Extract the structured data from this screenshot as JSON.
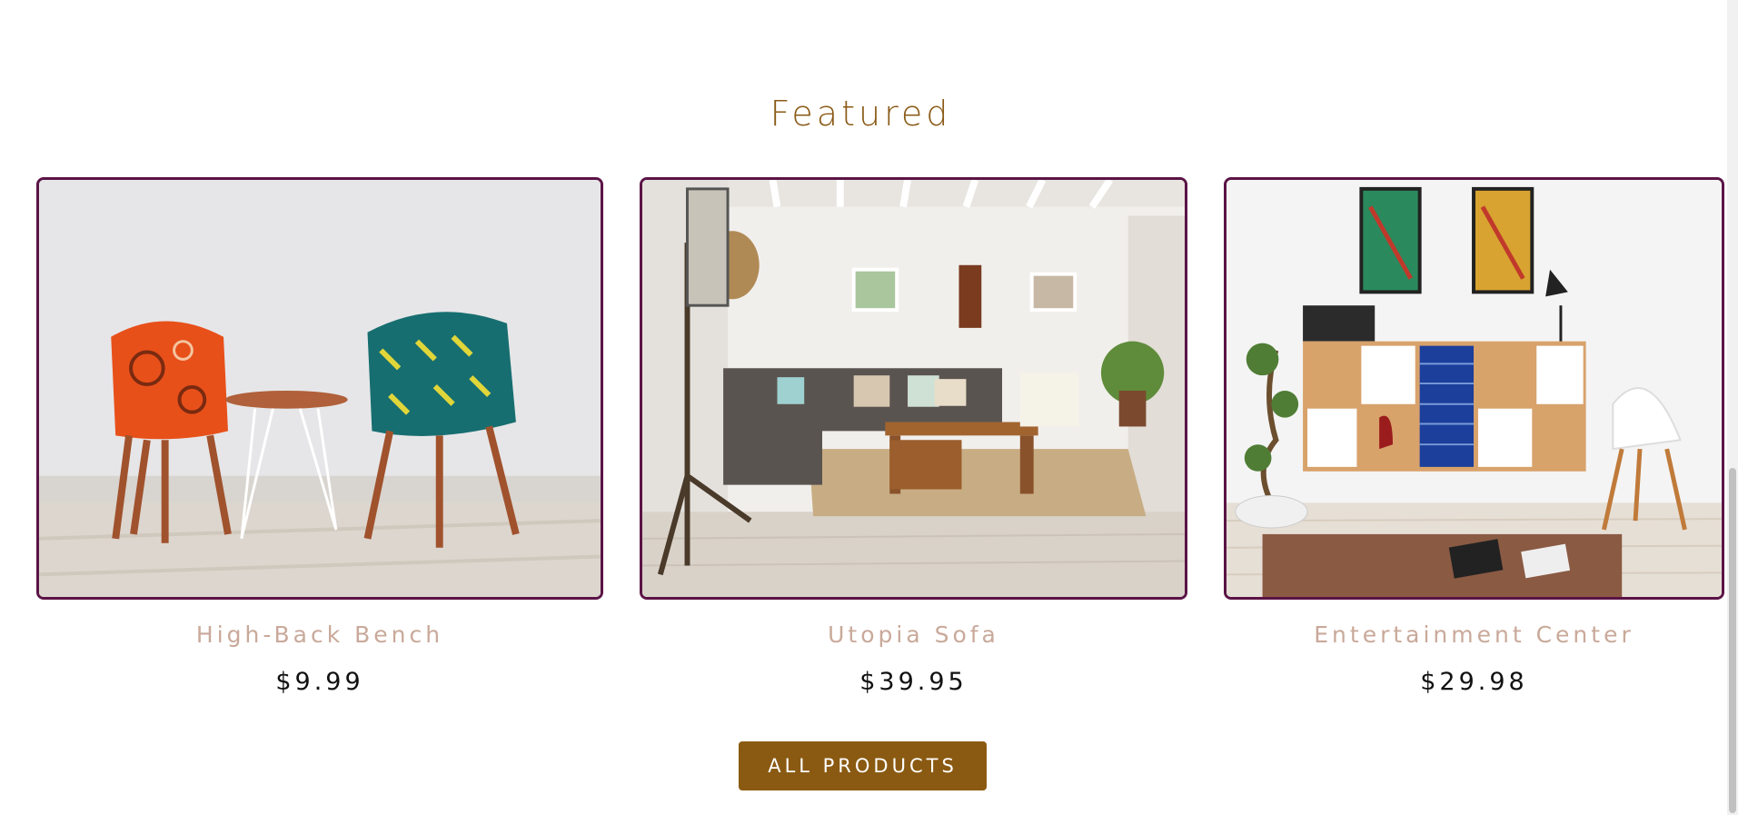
{
  "featured": {
    "title": "Featured",
    "products": [
      {
        "name": "High-Back Bench",
        "price": "$9.99",
        "image": "two-patterned-chairs-and-side-table"
      },
      {
        "name": "Utopia Sofa",
        "price": "$39.95",
        "image": "living-room-with-sofa"
      },
      {
        "name": "Entertainment Center",
        "price": "$29.98",
        "image": "storage-unit-with-artwork"
      }
    ]
  },
  "cta": {
    "label": "ALL PRODUCTS"
  },
  "colors": {
    "accent": "#8a5a12",
    "card_border": "#5b1446",
    "product_name": "#c9a99a"
  }
}
